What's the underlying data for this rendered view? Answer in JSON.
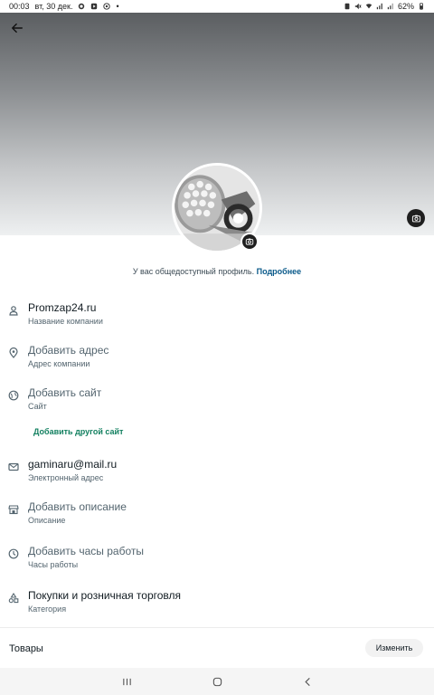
{
  "status_bar": {
    "time": "00:03",
    "date": "вт, 30 дек.",
    "dot": "•",
    "battery": "62%"
  },
  "profile": {
    "public_note": "У вас общедоступный профиль.",
    "public_link": "Подробнее"
  },
  "fields": [
    {
      "title": "Promzap24.ru",
      "subtitle": "Название компании",
      "icon": "person-icon"
    },
    {
      "title": "Добавить адрес",
      "subtitle": "Адрес компании",
      "icon": "location-icon"
    },
    {
      "title": "Добавить сайт",
      "subtitle": "Сайт",
      "icon": "globe-icon"
    },
    {
      "title": "gaminaru@mail.ru",
      "subtitle": "Электронный адрес",
      "icon": "mail-icon"
    },
    {
      "title": "Добавить описание",
      "subtitle": "Описание",
      "icon": "store-icon"
    },
    {
      "title": "Добавить часы работы",
      "subtitle": "Часы работы",
      "icon": "clock-icon"
    },
    {
      "title": "Покупки и розничная торговля",
      "subtitle": "Категория",
      "icon": "category-icon"
    }
  ],
  "add_other_site": "Добавить другой сайт",
  "goods": {
    "label": "Товары",
    "edit": "Изменить"
  }
}
